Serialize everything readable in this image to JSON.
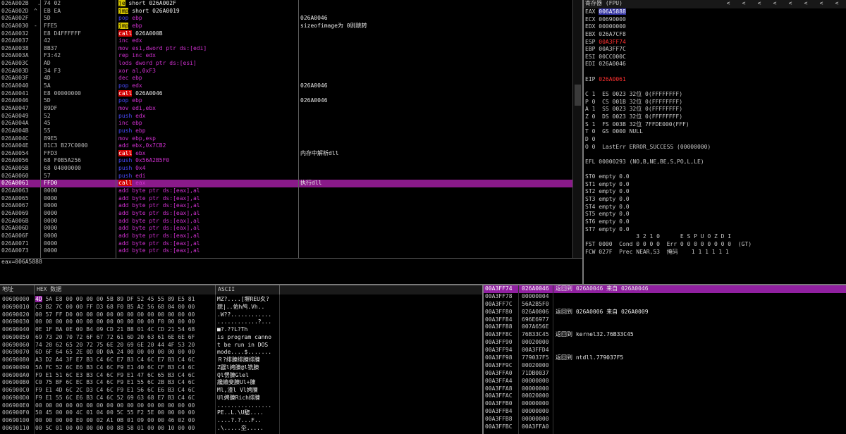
{
  "disasm": {
    "rows": [
      {
        "addr": "026A002B",
        "mark": " .",
        "bytes": "74 02",
        "mn": "je",
        "ops": " short 026A002F",
        "mncls": "yel",
        "opcls": "wht",
        "cmt": ""
      },
      {
        "addr": "026A002D",
        "mark": "^",
        "bytes": "EB EA",
        "mn": "jmp",
        "ops": " short 026A0019",
        "mncls": "yel",
        "opcls": "wht",
        "cmt": ""
      },
      {
        "addr": "026A002F",
        "mark": "",
        "bytes": "5D",
        "mn": "pop",
        "ops": " ebp",
        "mncls": "blu",
        "opcls": "pur",
        "cmt": "026A0046"
      },
      {
        "addr": "026A0030",
        "mark": "-",
        "bytes": "FFE5",
        "mn": "jmp",
        "ops": " ebp",
        "mncls": "yel",
        "opcls": "pur",
        "cmt": "sizeofimage为 0则跳转"
      },
      {
        "addr": "026A0032",
        "mark": "",
        "bytes": "E8 D4FFFFFF",
        "mn": "call",
        "ops": " 026A000B",
        "mncls": "red",
        "opcls": "wht",
        "cmt": ""
      },
      {
        "addr": "026A0037",
        "mark": "",
        "bytes": "42",
        "mn": "inc",
        "ops": " edx",
        "mncls": "pur",
        "opcls": "pur",
        "cmt": ""
      },
      {
        "addr": "026A0038",
        "mark": "",
        "bytes": "8B37",
        "mn": "mov",
        "ops": " esi,dword ptr ds:[edi]",
        "mncls": "pur",
        "opcls": "pur",
        "cmt": ""
      },
      {
        "addr": "026A003A",
        "mark": "",
        "bytes": "F3:42",
        "mn": "rep",
        "ops": " inc edx",
        "mncls": "pur",
        "opcls": "pur",
        "cmt": ""
      },
      {
        "addr": "026A003C",
        "mark": "",
        "bytes": "AD",
        "mn": "lods",
        "ops": " dword ptr ds:[esi]",
        "mncls": "pur",
        "opcls": "pur",
        "cmt": ""
      },
      {
        "addr": "026A003D",
        "mark": "",
        "bytes": "34 F3",
        "mn": "xor",
        "ops": " al,0xF3",
        "mncls": "pur",
        "opcls": "pur",
        "cmt": ""
      },
      {
        "addr": "026A003F",
        "mark": "",
        "bytes": "4D",
        "mn": "dec",
        "ops": " ebp",
        "mncls": "pur",
        "opcls": "pur",
        "cmt": ""
      },
      {
        "addr": "026A0040",
        "mark": "",
        "bytes": "5A",
        "mn": "pop",
        "ops": " edx",
        "mncls": "blu",
        "opcls": "pur",
        "cmt": "026A0046"
      },
      {
        "addr": "026A0041",
        "mark": "",
        "bytes": "E8 00000000",
        "mn": "call",
        "ops": " 026A0046",
        "mncls": "red",
        "opcls": "wht",
        "cmt": ""
      },
      {
        "addr": "026A0046",
        "mark": "",
        "bytes": "5D",
        "mn": "pop",
        "ops": " ebp",
        "mncls": "blu",
        "opcls": "pur",
        "cmt": "026A0046"
      },
      {
        "addr": "026A0047",
        "mark": "",
        "bytes": "89DF",
        "mn": "mov",
        "ops": " edi,ebx",
        "mncls": "pur",
        "opcls": "pur",
        "cmt": ""
      },
      {
        "addr": "026A0049",
        "mark": "",
        "bytes": "52",
        "mn": "push",
        "ops": " edx",
        "mncls": "blu",
        "opcls": "pur",
        "cmt": ""
      },
      {
        "addr": "026A004A",
        "mark": "",
        "bytes": "45",
        "mn": "inc",
        "ops": " ebp",
        "mncls": "pur",
        "opcls": "pur",
        "cmt": ""
      },
      {
        "addr": "026A004B",
        "mark": "",
        "bytes": "55",
        "mn": "push",
        "ops": " ebp",
        "mncls": "blu",
        "opcls": "pur",
        "cmt": ""
      },
      {
        "addr": "026A004C",
        "mark": "",
        "bytes": "89E5",
        "mn": "mov",
        "ops": " ebp,esp",
        "mncls": "pur",
        "opcls": "pur",
        "cmt": ""
      },
      {
        "addr": "026A004E",
        "mark": "",
        "bytes": "81C3 B27C0000",
        "mn": "add",
        "ops": " ebx,0x7CB2",
        "mncls": "pur",
        "opcls": "pur",
        "cmt": ""
      },
      {
        "addr": "026A0054",
        "mark": "",
        "bytes": "FFD3",
        "mn": "call",
        "ops": " ebx",
        "mncls": "red",
        "opcls": "pur",
        "cmt": "内存中解析dll"
      },
      {
        "addr": "026A0056",
        "mark": "",
        "bytes": "68 F0B5A256",
        "mn": "push",
        "ops": " 0x56A2B5F0",
        "mncls": "blu",
        "opcls": "pur",
        "cmt": ""
      },
      {
        "addr": "026A005B",
        "mark": "",
        "bytes": "68 04000000",
        "mn": "push",
        "ops": " 0x4",
        "mncls": "blu",
        "opcls": "pur",
        "cmt": ""
      },
      {
        "addr": "026A0060",
        "mark": "",
        "bytes": "57",
        "mn": "push",
        "ops": " edi",
        "mncls": "blu",
        "opcls": "pur",
        "cmt": ""
      },
      {
        "addr": "026A0061",
        "mark": "",
        "bytes": "FFD0",
        "mn": "call",
        "ops": " eax",
        "mncls": "red",
        "opcls": "pur",
        "cmt": "执行dll",
        "selected": true
      },
      {
        "addr": "026A0063",
        "mark": "",
        "bytes": "0000",
        "mn": "add",
        "ops": " byte ptr ds:[eax],al",
        "mncls": "pur",
        "opcls": "pur",
        "cmt": ""
      },
      {
        "addr": "026A0065",
        "mark": "",
        "bytes": "0000",
        "mn": "add",
        "ops": " byte ptr ds:[eax],al",
        "mncls": "pur",
        "opcls": "pur",
        "cmt": ""
      },
      {
        "addr": "026A0067",
        "mark": "",
        "bytes": "0000",
        "mn": "add",
        "ops": " byte ptr ds:[eax],al",
        "mncls": "pur",
        "opcls": "pur",
        "cmt": ""
      },
      {
        "addr": "026A0069",
        "mark": "",
        "bytes": "0000",
        "mn": "add",
        "ops": " byte ptr ds:[eax],al",
        "mncls": "pur",
        "opcls": "pur",
        "cmt": ""
      },
      {
        "addr": "026A006B",
        "mark": "",
        "bytes": "0000",
        "mn": "add",
        "ops": " byte ptr ds:[eax],al",
        "mncls": "pur",
        "opcls": "pur",
        "cmt": ""
      },
      {
        "addr": "026A006D",
        "mark": "",
        "bytes": "0000",
        "mn": "add",
        "ops": " byte ptr ds:[eax],al",
        "mncls": "pur",
        "opcls": "pur",
        "cmt": ""
      },
      {
        "addr": "026A006F",
        "mark": "",
        "bytes": "0000",
        "mn": "add",
        "ops": " byte ptr ds:[eax],al",
        "mncls": "pur",
        "opcls": "pur",
        "cmt": ""
      },
      {
        "addr": "026A0071",
        "mark": "",
        "bytes": "0000",
        "mn": "add",
        "ops": " byte ptr ds:[eax],al",
        "mncls": "pur",
        "opcls": "pur",
        "cmt": ""
      },
      {
        "addr": "026A0073",
        "mark": "",
        "bytes": "0000",
        "mn": "add",
        "ops": " byte ptr ds:[eax],al",
        "mncls": "pur",
        "opcls": "pur",
        "cmt": ""
      }
    ],
    "info": "eax=006A5888"
  },
  "registers": {
    "title": "寄存器 (FPU)",
    "nav": [
      "<",
      "<",
      "<",
      "<",
      "<",
      "<",
      "<",
      "<"
    ],
    "lines": [
      {
        "t": "EAX ",
        "v": "006A5888",
        "cls": "blueval"
      },
      {
        "t": "ECX 00690000",
        "v": "",
        "cls": ""
      },
      {
        "t": "EDX 00000000",
        "v": "",
        "cls": ""
      },
      {
        "t": "EBX 026A7CF8",
        "v": "",
        "cls": ""
      },
      {
        "t": "ESP ",
        "v": "00A3FF74",
        "cls": "regred"
      },
      {
        "t": "EBP 00A3FF7C",
        "v": "",
        "cls": ""
      },
      {
        "t": "ESI 00CC000C",
        "v": "",
        "cls": ""
      },
      {
        "t": "EDI 026A0046",
        "v": "",
        "cls": ""
      },
      {
        "t": "",
        "v": "",
        "cls": ""
      },
      {
        "t": "EIP ",
        "v": "026A0061",
        "cls": "regred"
      },
      {
        "t": "",
        "v": "",
        "cls": ""
      },
      {
        "t": "C 1  ES 0023 32位 0(FFFFFFFF)",
        "v": "",
        "cls": ""
      },
      {
        "t": "P 0  CS 001B 32位 0(FFFFFFFF)",
        "v": "",
        "cls": ""
      },
      {
        "t": "A 1  SS 0023 32位 0(FFFFFFFF)",
        "v": "",
        "cls": ""
      },
      {
        "t": "Z 0  DS 0023 32位 0(FFFFFFFF)",
        "v": "",
        "cls": ""
      },
      {
        "t": "S 1  FS 003B 32位 7FFDE000(FFF)",
        "v": "",
        "cls": ""
      },
      {
        "t": "T 0  GS 0000 NULL",
        "v": "",
        "cls": ""
      },
      {
        "t": "D 0",
        "v": "",
        "cls": ""
      },
      {
        "t": "O 0  LastErr ERROR_SUCCESS (00000000)",
        "v": "",
        "cls": ""
      },
      {
        "t": "",
        "v": "",
        "cls": ""
      },
      {
        "t": "EFL 00000293 (NO,B,NE,BE,S,PO,L,LE)",
        "v": "",
        "cls": ""
      },
      {
        "t": "",
        "v": "",
        "cls": ""
      },
      {
        "t": "ST0 empty 0.0",
        "v": "",
        "cls": ""
      },
      {
        "t": "ST1 empty 0.0",
        "v": "",
        "cls": ""
      },
      {
        "t": "ST2 empty 0.0",
        "v": "",
        "cls": ""
      },
      {
        "t": "ST3 empty 0.0",
        "v": "",
        "cls": ""
      },
      {
        "t": "ST4 empty 0.0",
        "v": "",
        "cls": ""
      },
      {
        "t": "ST5 empty 0.0",
        "v": "",
        "cls": ""
      },
      {
        "t": "ST6 empty 0.0",
        "v": "",
        "cls": ""
      },
      {
        "t": "ST7 empty 0.0",
        "v": "",
        "cls": ""
      },
      {
        "t": "               3 2 1 0      E S P U O Z D I",
        "v": "",
        "cls": ""
      },
      {
        "t": "FST 0000  Cond 0 0 0 0  Err 0 0 0 0 0 0 0 0  (GT)",
        "v": "",
        "cls": ""
      },
      {
        "t": "FCW 027F  Prec NEAR,53  掩码    1 1 1 1 1 1",
        "v": "",
        "cls": ""
      }
    ]
  },
  "dump": {
    "headers": {
      "addr": "地址",
      "hex": "HEX 数据",
      "ascii": "ASCII"
    },
    "rows": [
      {
        "addr": "00690000",
        "hex": "4D 5A E8 00 00 00 00 5B 89 DF 52 45 55 89 E5 81",
        "ascii": "MZ?....[塀REU夊?",
        "sel": true
      },
      {
        "addr": "00690010",
        "hex": "C3 B2 7C 00 00 FF D3 68 F0 B5 A2 56 68 04 00 00",
        "ascii": "貌|..佑h鸬.Vh..",
        "sel": false
      },
      {
        "addr": "00690020",
        "hex": "00 57 FF D0 00 00 00 00 00 00 00 00 00 00 00 00",
        "ascii": ".W??............",
        "sel": false
      },
      {
        "addr": "00690030",
        "hex": "00 00 00 00 00 00 00 00 00 00 00 00 F0 00 00 00",
        "ascii": "............?...",
        "sel": false
      },
      {
        "addr": "00690040",
        "hex": "0E 1F BA 0E 00 B4 09 CD 21 B8 01 4C CD 21 54 68",
        "ascii": "■?.??L?Th",
        "sel": false
      },
      {
        "addr": "00690050",
        "hex": "69 73 20 70 72 6F 67 72 61 6D 20 63 61 6E 6E 6F",
        "ascii": "is program canno",
        "sel": false
      },
      {
        "addr": "00690060",
        "hex": "74 20 62 65 20 72 75 6E 20 69 6E 20 44 4F 53 20",
        "ascii": "t be run in DOS ",
        "sel": false
      },
      {
        "addr": "00690070",
        "hex": "6D 6F 64 65 2E 0D 0D 0A 24 00 00 00 00 00 00 00",
        "ascii": "mode....$.......",
        "sel": false
      },
      {
        "addr": "00690080",
        "hex": "A3 D2 A4 3F E7 B3 C4 6C E7 B3 C4 6C E7 B3 C4 6C",
        "ascii": "Ｒ?绯腖绯腖绯腖",
        "sel": false
      },
      {
        "addr": "00690090",
        "hex": "5A FC 52 6C E6 B3 C4 6C F9 E1 40 6C CF B3 C4 6C",
        "ascii": "Z鼹l娉腖@l铣腖",
        "sel": false
      },
      {
        "addr": "006900A0",
        "hex": "F9 E1 51 6C E3 B3 C4 6C F9 E1 47 6C 65 B3 C4 6C",
        "ascii": "Ql愣腖Glel",
        "sel": false
      },
      {
        "addr": "006900B0",
        "hex": "C0 75 BF 6C EC B3 C4 6C F9 E1 55 6C 2B B3 C4 6C",
        "ascii": "纔縧斐腖Ul+腖",
        "sel": false
      },
      {
        "addr": "006900C0",
        "hex": "F9 E1 4D 6C 2C D3 C4 6C F9 E1 56 6C E6 B3 C4 6C",
        "ascii": "Ml,渣l Vl娉腖",
        "sel": false
      },
      {
        "addr": "006900D0",
        "hex": "F9 E1 55 6C E6 B3 C4 6C 52 69 63 68 E7 B3 C4 6C",
        "ascii": "Ul娉腖Rich绯腖",
        "sel": false
      },
      {
        "addr": "006900E0",
        "hex": "00 00 00 00 00 00 00 00 00 00 00 00 00 00 00 00",
        "ascii": "................",
        "sel": false
      },
      {
        "addr": "006900F0",
        "hex": "50 45 00 00 4C 01 04 00 5C 55 F2 5E 00 00 00 00",
        "ascii": "PE..L.\\U騘....",
        "sel": false
      },
      {
        "addr": "00690100",
        "hex": "00 00 00 00 E0 00 02 A1 0B 01 09 00 00 46 02 00",
        "ascii": "....?.?...F..",
        "sel": false
      },
      {
        "addr": "00690110",
        "hex": "00 5C 01 00 00 00 00 00 88 58 01 00 00 10 00 00",
        "ascii": ".\\.....圶.....",
        "sel": false
      }
    ]
  },
  "stack": {
    "rows": [
      {
        "addr": "00A3FF74",
        "val": "026A0046",
        "cmt": "返回到 026A0046 来自 026A0046",
        "sel": true
      },
      {
        "addr": "00A3FF78",
        "val": "00000004",
        "cmt": "",
        "sel": false
      },
      {
        "addr": "00A3FF7C",
        "val": "56A2B5F0",
        "cmt": "",
        "sel": false
      },
      {
        "addr": "00A3FF80",
        "val": "026A0006",
        "cmt": "返回到 026A0006 来自 026A0009",
        "sel": false
      },
      {
        "addr": "00A3FF84",
        "val": "696E6977",
        "cmt": "",
        "sel": false
      },
      {
        "addr": "00A3FF88",
        "val": "007A656E",
        "cmt": "",
        "sel": false
      },
      {
        "addr": "00A3FF8C",
        "val": "76B33C45",
        "cmt": "返回到 kernel32.76B33C45",
        "sel": false
      },
      {
        "addr": "00A3FF90",
        "val": "00020000",
        "cmt": "",
        "sel": false
      },
      {
        "addr": "00A3FF94",
        "val": "00A3FFD4",
        "cmt": "",
        "sel": false
      },
      {
        "addr": "00A3FF98",
        "val": "779037F5",
        "cmt": "返回到 ntdll.779037F5",
        "sel": false
      },
      {
        "addr": "00A3FF9C",
        "val": "00020000",
        "cmt": "",
        "sel": false
      },
      {
        "addr": "00A3FFA0",
        "val": "71DB0037",
        "cmt": "",
        "sel": false
      },
      {
        "addr": "00A3FFA4",
        "val": "00000000",
        "cmt": "",
        "sel": false
      },
      {
        "addr": "00A3FFA8",
        "val": "00000000",
        "cmt": "",
        "sel": false
      },
      {
        "addr": "00A3FFAC",
        "val": "00020000",
        "cmt": "",
        "sel": false
      },
      {
        "addr": "00A3FFB0",
        "val": "00000000",
        "cmt": "",
        "sel": false
      },
      {
        "addr": "00A3FFB4",
        "val": "00000000",
        "cmt": "",
        "sel": false
      },
      {
        "addr": "00A3FFB8",
        "val": "00000000",
        "cmt": "",
        "sel": false
      },
      {
        "addr": "00A3FFBC",
        "val": "00A3FFA0",
        "cmt": "",
        "sel": false
      }
    ]
  }
}
